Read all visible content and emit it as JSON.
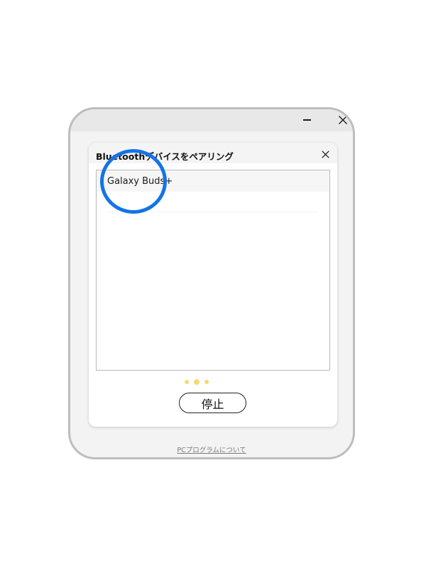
{
  "window": {
    "minimize_icon": "minimize-icon",
    "close_icon": "close-icon"
  },
  "dialog": {
    "title": "Bluetoothデバイスをペアリング",
    "close_icon": "close-icon"
  },
  "device_list": {
    "items": [
      {
        "name": "Galaxy Buds+"
      }
    ]
  },
  "loading_indicator": {
    "dots": 3,
    "color": "#f2da73"
  },
  "stop_button": {
    "label": "停止"
  },
  "footer": {
    "link_label": "PCプログラムについて"
  },
  "colors": {
    "highlight": "#1473e6",
    "window_border": "#bdbdbd",
    "window_background": "#f3f3f3"
  }
}
